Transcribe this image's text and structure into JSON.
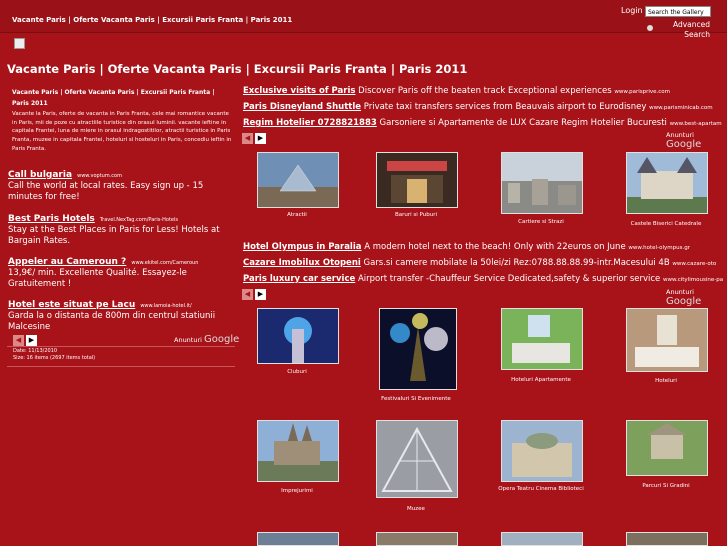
{
  "top": {
    "breadcrumb": "Vacante Paris | Oferte Vacanta Paris | Excursii Paris Franta | Paris 2011",
    "login": "Login |",
    "search_value": "Search the Gallery",
    "advanced_search": "Advanced Search"
  },
  "page_title": "Vacante Paris | Oferte Vacanta Paris | Excursii Paris Franta | Paris 2011",
  "left": {
    "header": "Vacante Paris | Oferte Vacanta Paris | Excursii Paris Franta | Paris 2011",
    "description": "Vacante la Paris, oferte de vacanta in Paris Franta, cele mai romantice vacante in Paris, mii de poze cu atractiile turistice din orasul luminii. vacante ieftine in capitala Frantei, luna de miere in orasul indragostitilor, atractii turistice in Paris Franta, muzee in capitala Frantei, hoteluri si hosteluri in Paris, concediu ieftin in Paris Franta.",
    "ads": [
      {
        "title": "Call bulgaria",
        "url": "www.voptum.com",
        "desc": "Call the world at local rates. Easy sign up - 15 minutes for free!"
      },
      {
        "title": "Best Paris Hotels",
        "url": "Travel.NexTag.com/Paris-Hotels",
        "desc": "Stay at the Best Places in Paris for Less! Hotels at Bargain Rates."
      },
      {
        "title": "Appeler au Cameroun ?",
        "url": "www.ekitel.com/Cameroun",
        "desc": "13,9€/ min. Excellente Qualité. Essayez-le Gratuitement !"
      },
      {
        "title": "Hotel este situat pe Lacu",
        "url": "www.lamoia-hotel.it/",
        "desc": "Garda la o distanta de 800m din centrul statiunii Malcesine"
      }
    ],
    "anunturi": "Anunturi",
    "google": "Google",
    "date": "Date: 11/13/2010",
    "size": "Size: 16 items (2697 items total)"
  },
  "right_ads_1": [
    {
      "title": "Exclusive visits of Paris",
      "desc": "Discover Paris off the beaten track Exceptional experiences",
      "url": "www.parisprive.com"
    },
    {
      "title": "Paris Disneyland Shuttle",
      "desc": "Private taxi transfers services from Beauvais airport to Eurodisney",
      "url": "www.parisminicab.com"
    },
    {
      "title": "Regim Hotelier 0728821883",
      "desc": "Garsoniere si Apartamente de LUX Cazare Regim Hotelier Bucuresti",
      "url": "www.best-apartam"
    }
  ],
  "right_ads_2": [
    {
      "title": "Hotel Olympus in Paralia",
      "desc": "A modern hotel next to the beach! Only with 22euros on June",
      "url": "www.hotel-olympus.gr"
    },
    {
      "title": "Cazare Imobilux Otopeni",
      "desc": "Gars.si camere mobilate la 50lei/zi Rez:0788.88.88.99-intr.Macesului 4B",
      "url": "www.cazare-oto"
    },
    {
      "title": "Paris luxury car service",
      "desc": "Airport transfer -Chauffeur Service Dedicated,safety & superior service",
      "url": "www.citylimousine-pa"
    }
  ],
  "gallery_row1": [
    "Atractii",
    "Baruri si Puburi",
    "Cartiere si Strazi",
    "Castele Biserici Catedrale"
  ],
  "gallery_row2": [
    "Cluburi",
    "Festivaluri Si Evenimente",
    "Hoteluri Apartamente",
    "Hoteluri"
  ],
  "gallery_row3": [
    "Imprejurimi",
    "Muzee",
    "Opera Teatru Cinema Biblioteci",
    "Parcuri Si Gradini"
  ],
  "colors": {
    "background": "#a8131a",
    "topbar": "#9a1118"
  }
}
